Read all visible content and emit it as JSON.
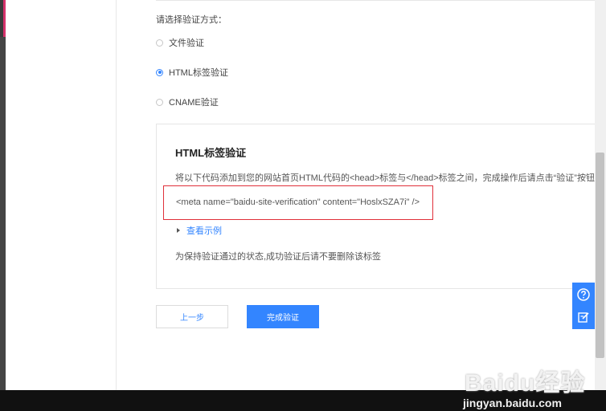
{
  "verify": {
    "prompt": "请选择验证方式：",
    "options": [
      {
        "label": "文件验证",
        "checked": false
      },
      {
        "label": "HTML标签验证",
        "checked": true
      },
      {
        "label": "CNAME验证",
        "checked": false
      }
    ]
  },
  "panel": {
    "title": "HTML标签验证",
    "description": "将以下代码添加到您的网站首页HTML代码的<head>标签与</head>标签之间，完成操作后请点击“验证”按钮。",
    "code": "<meta name=\"baidu-site-verification\" content=\"HoslxSZA7i\" />",
    "example_link": "查看示例",
    "tip": "为保持验证通过的状态,成功验证后请不要删除该标签"
  },
  "buttons": {
    "prev": "上一步",
    "done": "完成验证"
  },
  "side_tools": [
    "help-icon",
    "feedback-edit-icon"
  ],
  "watermark": {
    "brand": "Baidu经验",
    "url": "jingyan.baidu.com"
  },
  "colors": {
    "accent": "#3385ff",
    "highlight_box": "#e0303a"
  }
}
